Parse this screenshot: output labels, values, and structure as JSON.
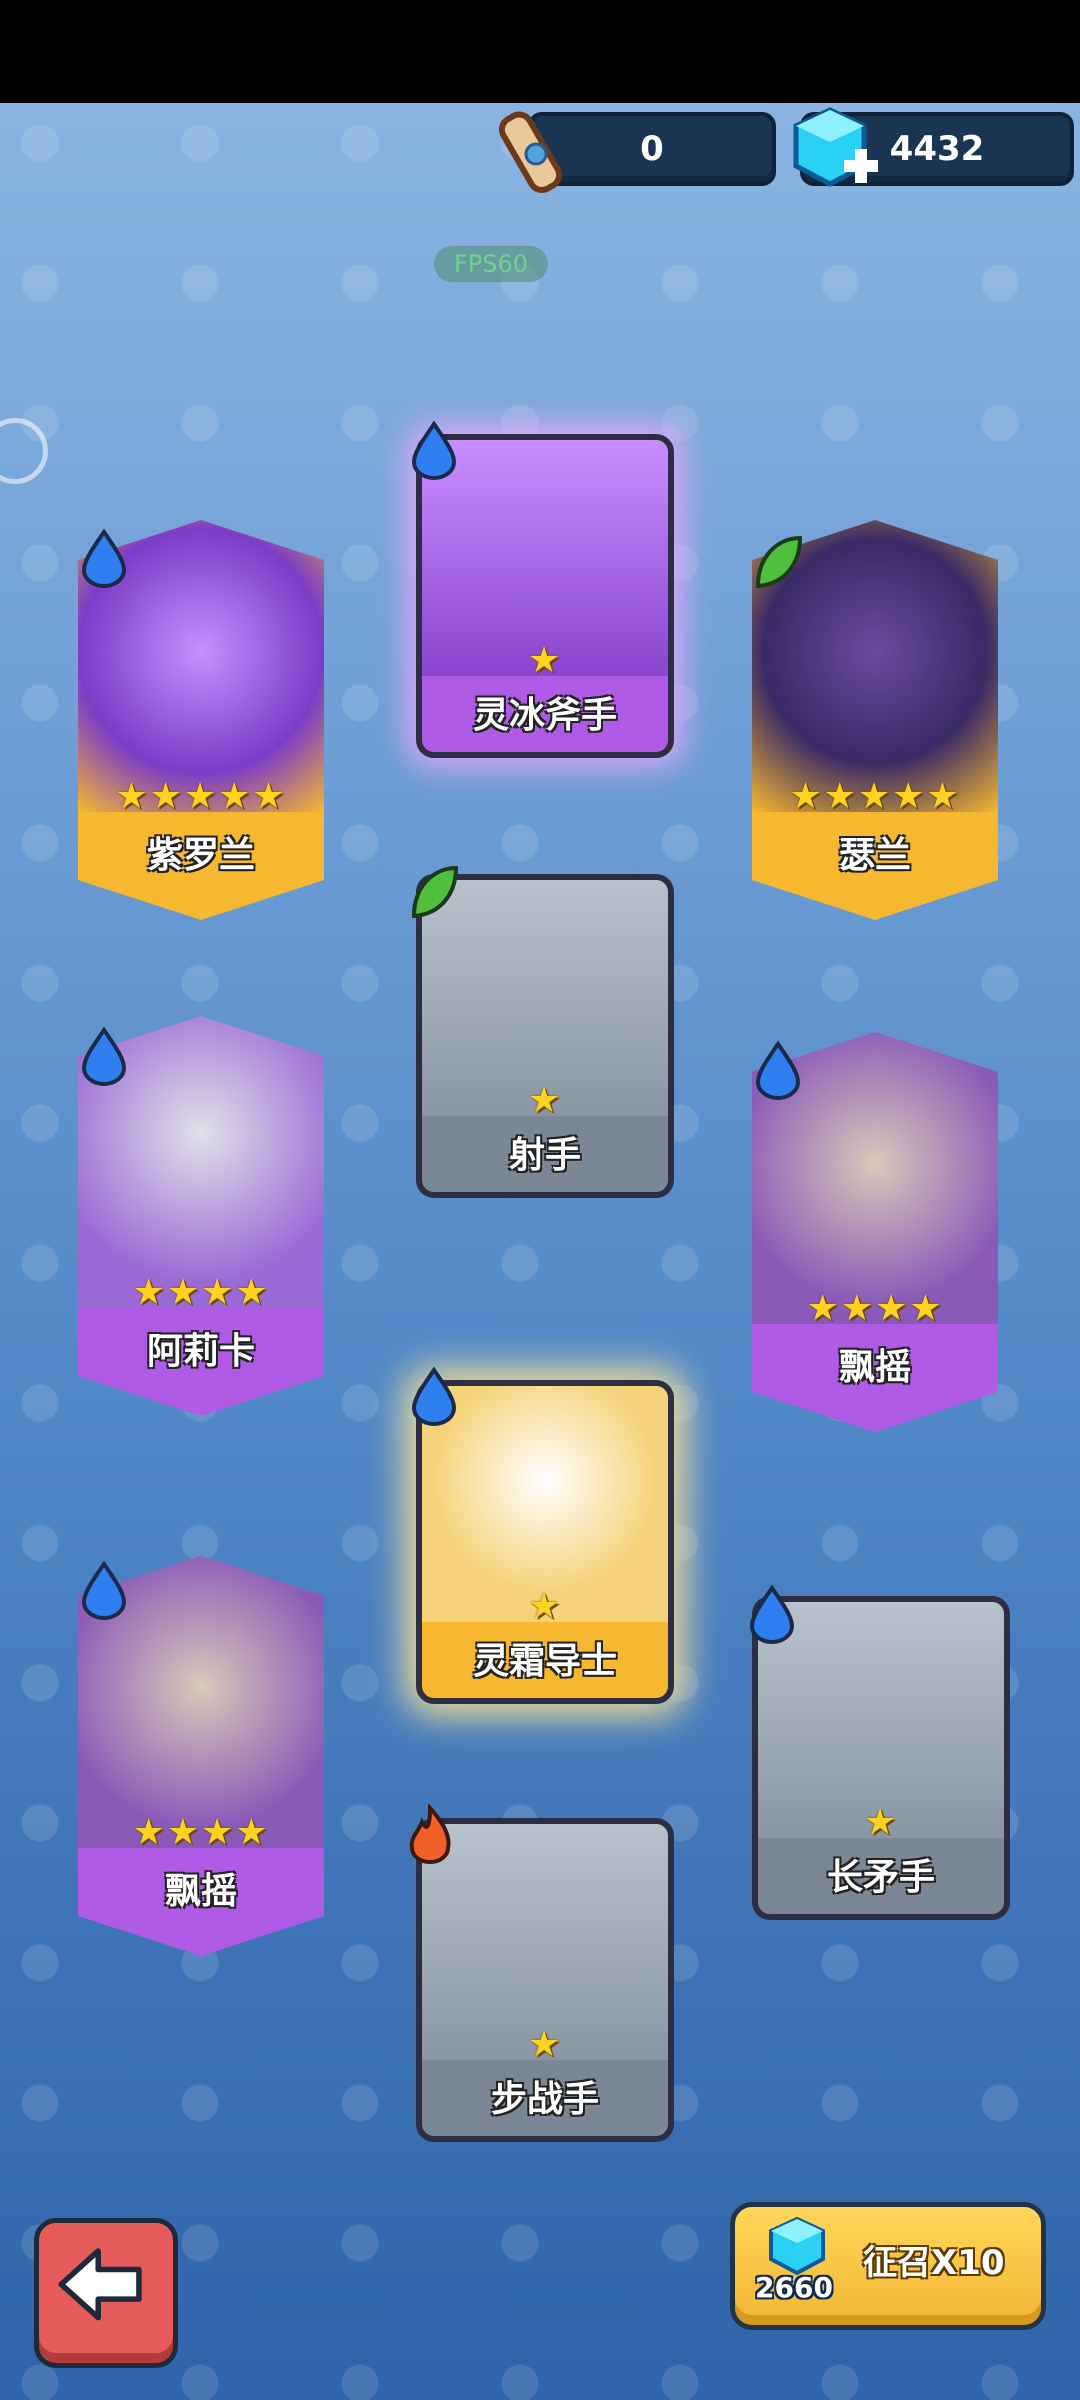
{
  "resources": {
    "scrolls": "0",
    "gems": "4432"
  },
  "fps_label": "FPS60",
  "cards": [
    {
      "name": "紫罗兰",
      "stars": "★★★★★",
      "element": "water",
      "rarity": "legendary"
    },
    {
      "name": "灵冰斧手",
      "stars": "★",
      "element": "water",
      "rarity": "epic"
    },
    {
      "name": "瑟兰",
      "stars": "★★★★★",
      "element": "leaf",
      "rarity": "legendary"
    },
    {
      "name": "射手",
      "stars": "★",
      "element": "leaf",
      "rarity": "common"
    },
    {
      "name": "阿莉卡",
      "stars": "★★★★",
      "element": "water",
      "rarity": "epic"
    },
    {
      "name": "飘摇",
      "stars": "★★★★",
      "element": "water",
      "rarity": "epic"
    },
    {
      "name": "灵霜导士",
      "stars": "★",
      "element": "water",
      "rarity": "legendary"
    },
    {
      "name": "飘摇",
      "stars": "★★★★",
      "element": "water",
      "rarity": "epic"
    },
    {
      "name": "长矛手",
      "stars": "★",
      "element": "water",
      "rarity": "common"
    },
    {
      "name": "步战手",
      "stars": "★",
      "element": "fire",
      "rarity": "common"
    }
  ],
  "summon": {
    "label": "征召X10",
    "cost": "2660"
  },
  "colors": {
    "legendary": "#f6b830",
    "epic": "#b05be6",
    "common": "#7c8796",
    "water": "#2f7ff0",
    "leaf": "#4fbf3d",
    "fire": "#f2602a"
  }
}
